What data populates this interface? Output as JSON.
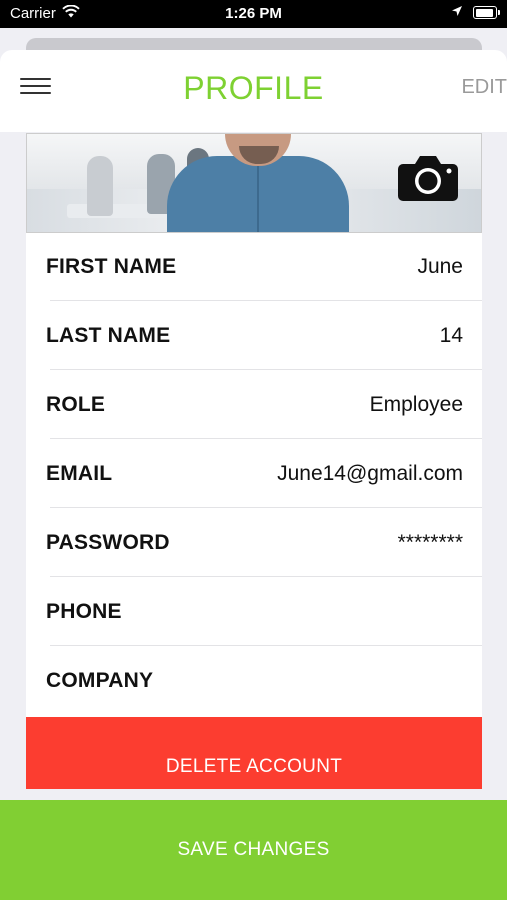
{
  "status_bar": {
    "carrier": "Carrier",
    "time": "1:26 PM",
    "wifi_icon": "wifi-icon",
    "location_icon": "location-arrow-icon",
    "battery_icon": "battery-icon"
  },
  "header": {
    "title": "PROFILE",
    "edit_label": "EDIT",
    "menu_icon": "hamburger-menu-icon",
    "title_color": "#7ed132"
  },
  "photo": {
    "camera_icon": "camera-icon"
  },
  "fields": [
    {
      "label": "FIRST NAME",
      "value": "June"
    },
    {
      "label": "LAST NAME",
      "value": "14"
    },
    {
      "label": "ROLE",
      "value": "Employee"
    },
    {
      "label": "EMAIL",
      "value": "June14@gmail.com"
    },
    {
      "label": "PASSWORD",
      "value": "********"
    },
    {
      "label": "PHONE",
      "value": ""
    },
    {
      "label": "COMPANY",
      "value": ""
    }
  ],
  "actions": {
    "delete_label": "DELETE ACCOUNT",
    "save_label": "SAVE CHANGES",
    "delete_color": "#fc3d30",
    "save_color": "#81cf33"
  }
}
